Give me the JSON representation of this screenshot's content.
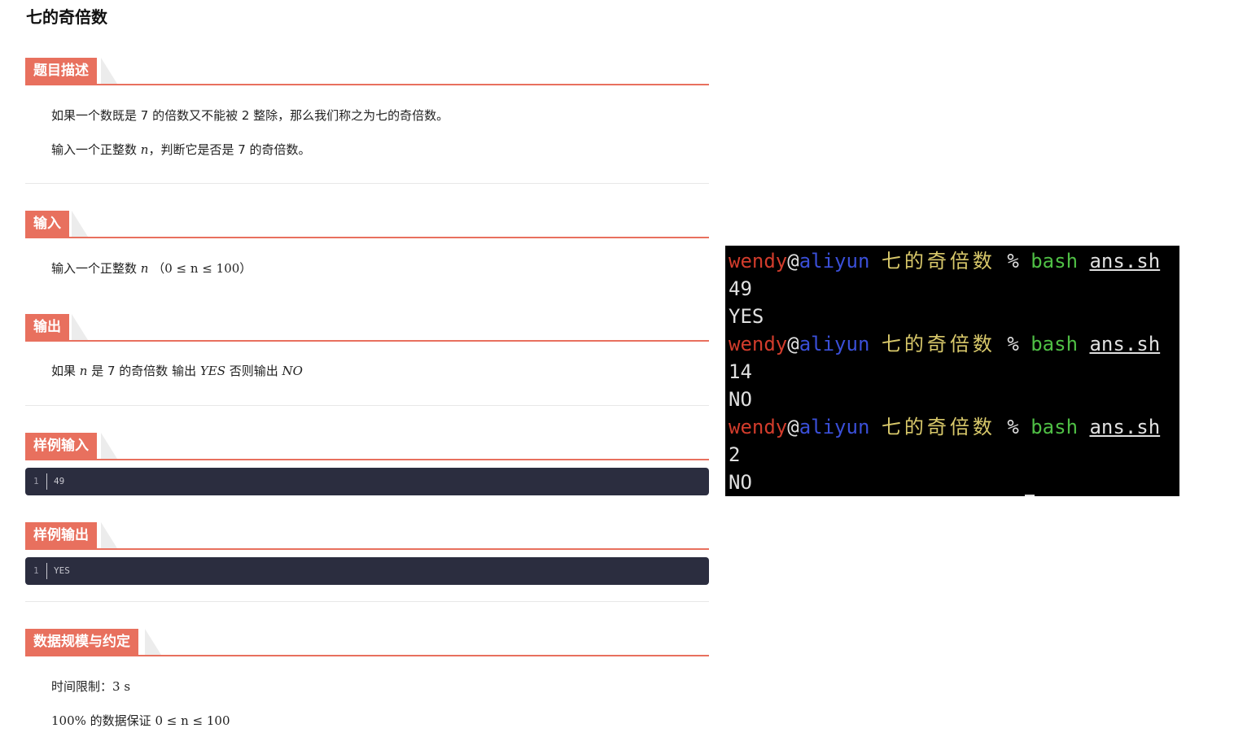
{
  "page_title": "七的奇倍数",
  "sections": {
    "description": {
      "heading": "题目描述",
      "p1": "如果一个数既是 7 的倍数又不能被 2 整除，那么我们称之为七的奇倍数。",
      "p2_pre": "输入一个正整数 ",
      "p2_var": "n",
      "p2_post": "，判断它是否是 7 的奇倍数。"
    },
    "input": {
      "heading": "输入",
      "p_pre": "输入一个正整数 ",
      "p_var": "n",
      "p_cond": "（0 ≤ n ≤ 100）"
    },
    "output": {
      "heading": "输出",
      "p_pre": "如果 ",
      "p_var": "n",
      "p_mid": " 是 7 的奇倍数 输出 ",
      "p_yes": "YES",
      "p_mid2": " 否则输出 ",
      "p_no": "NO"
    },
    "sample_input": {
      "heading": "样例输入",
      "line_no": "1",
      "code": "49"
    },
    "sample_output": {
      "heading": "样例输出",
      "line_no": "1",
      "code": "YES"
    },
    "constraints": {
      "heading": "数据规模与约定",
      "time_label": "时间限制：",
      "time_value": "3 s",
      "data_pct": "100%",
      "data_text": " 的数据保证 ",
      "data_cond": "0 ≤ n ≤ 100"
    }
  },
  "terminal": {
    "user": "wendy",
    "at": "@",
    "host": "aliyun",
    "dir": "七的奇倍数",
    "prompt": "%",
    "cmd": "bash",
    "arg": "ans.sh",
    "runs": [
      {
        "input": "49",
        "output": "YES"
      },
      {
        "input": "14",
        "output": "NO"
      },
      {
        "input": "2",
        "output": "NO"
      }
    ]
  },
  "colors": {
    "accent": "#e8705e",
    "code_bg": "#2b2d3f",
    "term_user": "#d23c2c",
    "term_host": "#3a4fd8",
    "term_dir": "#d8c86a",
    "term_cmd": "#4fbf45"
  }
}
